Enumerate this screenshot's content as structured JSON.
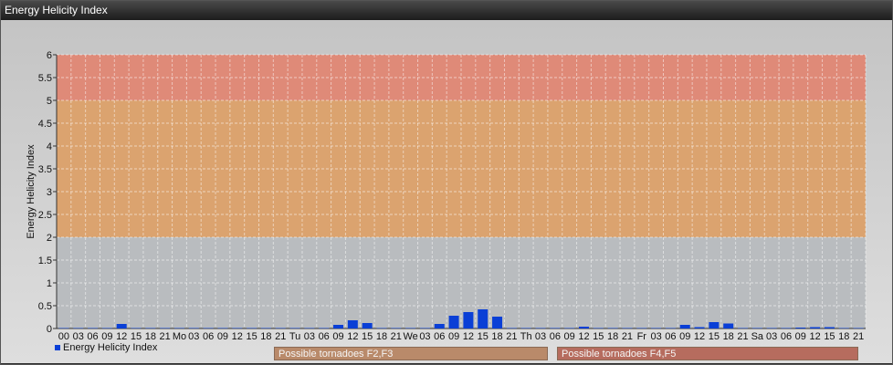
{
  "window": {
    "title": "Energy Helicity Index"
  },
  "colors": {
    "bar": "#0a3fd6",
    "zone_low": "#b9bcbf",
    "zone_mid": "#dba36f",
    "zone_high": "#df8a78"
  },
  "legend": {
    "series_label": "Energy Helicity Index"
  },
  "zones": [
    {
      "label": "Possible tornadoes F2,F3",
      "from": 2,
      "to": 5
    },
    {
      "label": "Possible tornadoes F4,F5",
      "from": 5,
      "to": 6
    }
  ],
  "chart_data": {
    "type": "bar",
    "title": "",
    "xlabel": "",
    "ylabel": "Energy Helicity Index",
    "ylim": [
      0,
      6
    ],
    "yticks": [
      "0",
      "0.5",
      "1",
      "1.5",
      "2",
      "2.5",
      "3",
      "3.5",
      "4",
      "4.5",
      "5",
      "5.5",
      "6"
    ],
    "grid": true,
    "legend_position": "bottom-left",
    "categories": [
      "00",
      "03",
      "06",
      "09",
      "12",
      "15",
      "18",
      "21",
      "Mo",
      "03",
      "06",
      "09",
      "12",
      "15",
      "18",
      "21",
      "Tu",
      "03",
      "06",
      "09",
      "12",
      "15",
      "18",
      "21",
      "We",
      "03",
      "06",
      "09",
      "12",
      "15",
      "18",
      "21",
      "Th",
      "03",
      "06",
      "09",
      "12",
      "15",
      "18",
      "21",
      "Fr",
      "03",
      "06",
      "09",
      "12",
      "15",
      "18",
      "21",
      "Sa",
      "03",
      "06",
      "09",
      "12",
      "15",
      "18",
      "21"
    ],
    "series": [
      {
        "name": "Energy Helicity Index",
        "values": [
          0.01,
          0.01,
          0.01,
          0.01,
          0.1,
          0.01,
          0.01,
          0.01,
          0.01,
          0.01,
          0.01,
          0.01,
          0.01,
          0.01,
          0.01,
          0.01,
          0.01,
          0.01,
          0.01,
          0.08,
          0.18,
          0.12,
          0.01,
          0.01,
          0.01,
          0.01,
          0.1,
          0.28,
          0.36,
          0.42,
          0.26,
          0.01,
          0.01,
          0.01,
          0.01,
          0.01,
          0.04,
          0.01,
          0.01,
          0.01,
          0.01,
          0.01,
          0.01,
          0.08,
          0.03,
          0.14,
          0.11,
          0.01,
          0.01,
          0.01,
          0.01,
          0.02,
          0.03,
          0.03,
          0.01,
          0.01
        ]
      }
    ]
  }
}
